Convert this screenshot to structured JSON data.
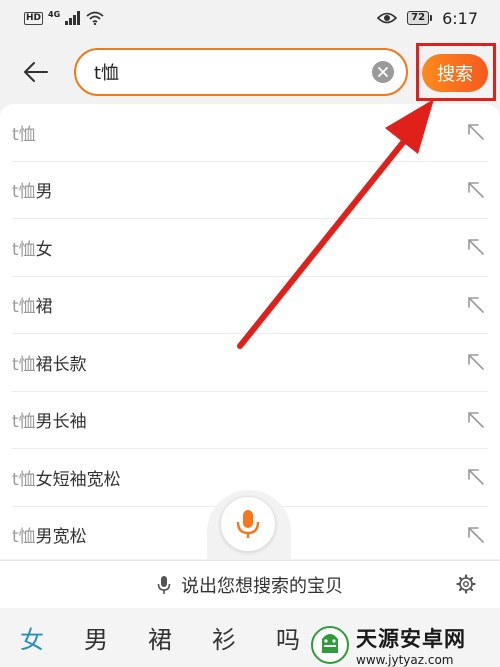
{
  "status_bar": {
    "hd": "HD",
    "network": "4G",
    "battery": "72",
    "time": "6:17"
  },
  "search": {
    "query": "t恤",
    "submit_label": "搜索"
  },
  "suggestions": [
    {
      "prefix": "t恤",
      "rest": ""
    },
    {
      "prefix": "t恤",
      "rest": "男"
    },
    {
      "prefix": "t恤",
      "rest": "女"
    },
    {
      "prefix": "t恤",
      "rest": "裙"
    },
    {
      "prefix": "t恤",
      "rest": "裙长款"
    },
    {
      "prefix": "t恤",
      "rest": "男长袖"
    },
    {
      "prefix": "t恤",
      "rest": "女短袖宽松"
    },
    {
      "prefix": "t恤",
      "rest": "男宽松"
    }
  ],
  "voice": {
    "prompt": "说出您想搜索的宝贝"
  },
  "keyboard": {
    "candidates": [
      "女",
      "男",
      "裙",
      "衫",
      "吗"
    ]
  },
  "watermark": {
    "title": "天源安卓网",
    "url": "www.jytyaz.com"
  },
  "colors": {
    "accent": "#f6591d",
    "annotation": "#e0201a",
    "candidate_active": "#2a8fbd"
  }
}
